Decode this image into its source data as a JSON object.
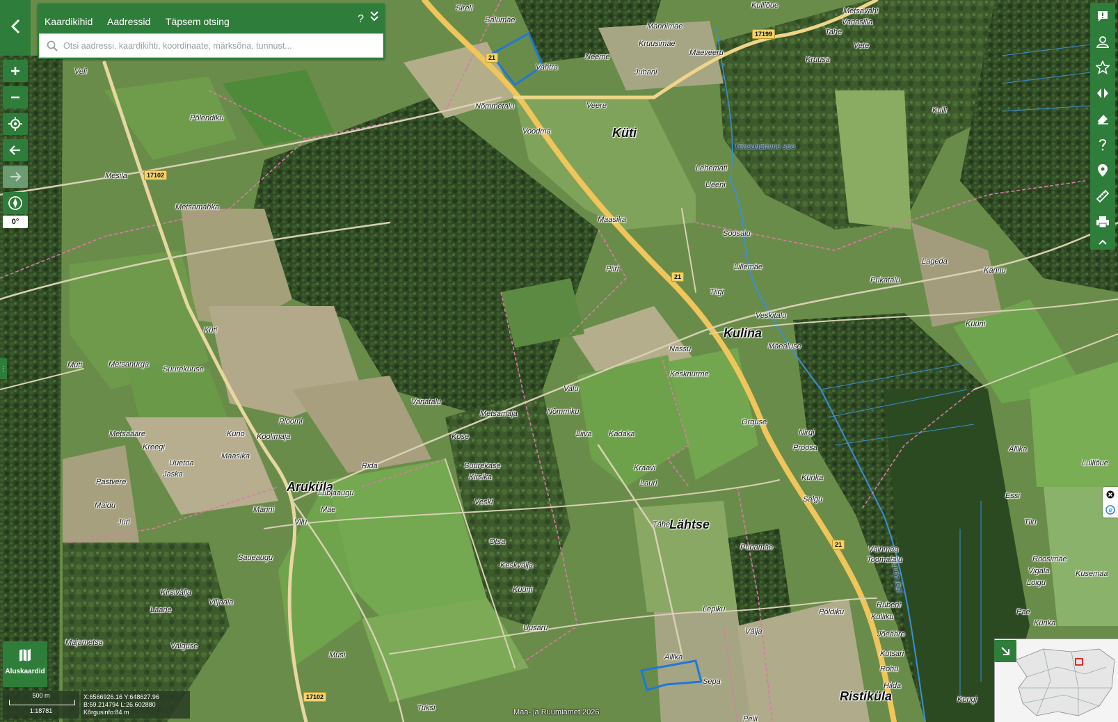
{
  "search_panel": {
    "tabs": [
      "Kaardikihid",
      "Aadressid",
      "Täpsem otsing"
    ],
    "help_label": "?",
    "placeholder": "Otsi aadressi, kaardikihti, koordinaate, märksõna, tunnust..."
  },
  "left_toolbar": {
    "buttons": [
      "zoom-in",
      "zoom-out",
      "locate",
      "back",
      "forward",
      "compass"
    ],
    "rotation": "0°"
  },
  "right_toolbar": {
    "buttons": [
      "feedback",
      "user",
      "favorites",
      "compare",
      "eraser",
      "help",
      "location-pin",
      "measure",
      "print",
      "collapse"
    ]
  },
  "basemap": {
    "label": "Aluskaardid"
  },
  "scale": {
    "distance": "500 m",
    "ratio": "1:18781"
  },
  "coords": {
    "xy": "X:6566926.16 Y:648627.96",
    "bl": "B:59.214794 L:26.602880",
    "height": "Kõrgusinfo:84 m"
  },
  "copyright": "Maa- ja Ruumiamet 2026",
  "road_numbers": [
    "21",
    "21",
    "21",
    "17199",
    "17102",
    "17102"
  ],
  "places": {
    "big": [
      "Küti",
      "Kulina",
      "Aruküla",
      "Lähtse",
      "Ristiküla"
    ],
    "small": [
      "Sireli",
      "Salumäe",
      "Männimäe",
      "Kulliõue",
      "Metsavahi",
      "Vanasilla",
      "Tahe",
      "Vete",
      "Kruusimäe",
      "Mäeveeru",
      "Kruusa",
      "Neeme",
      "Juhani",
      "Vahtra",
      "Veli",
      "Nõmmetalu",
      "Veere",
      "Voodma",
      "Kulli",
      "Põlendiku",
      "Lehemati",
      "Ueeni",
      "Mesila",
      "Metsamahka",
      "Maasika",
      "Soosalu",
      "Lillemäe",
      "Lageda",
      "Kännu",
      "Piiri",
      "Pukatalu",
      "Tiigi",
      "Veskitalu",
      "Küüni",
      "Mäealuse",
      "Küti",
      "Muti",
      "Metsanurga",
      "Suurekuuse",
      "Nassu",
      "Kesknurme",
      "Valu",
      "Vanatalu",
      "Nõmmiku",
      "Metsamaja",
      "Orguse",
      "Ploomi",
      "Metsaääre",
      "Kreegi",
      "Kuno",
      "Koolimaja",
      "Liiva",
      "Kadaka",
      "Kose",
      "Nirgi",
      "Proosa",
      "Allika",
      "Lulliõue",
      "Uuetoa",
      "Maasika",
      "Suurekase",
      "Kirsika",
      "Jaska",
      "Rida",
      "Kraavi",
      "Lauri",
      "Künka",
      "Salgu",
      "Pastvere",
      "Lubjaaugu",
      "Essi",
      "Maidu",
      "Männi",
      "Mäe",
      "Veski",
      "Jüri",
      "Vilu",
      "Tähe",
      "Väinmaa",
      "Toomatalu",
      "Tiiu",
      "Punamäe",
      "Roosimäe",
      "Vigala",
      "Kusemaa",
      "Saueaugu",
      "Otsa",
      "Loigu",
      "Keskvälja",
      "Kirsivälja",
      "Viljaaia",
      "Küüni",
      "Lepiku",
      "Põldiku",
      "Rubeni",
      "Pae",
      "Laane",
      "Kulliku",
      "Uusaru",
      "Välja",
      "Jõeääre",
      "Künka",
      "Majametsa",
      "Valguse",
      "Musi",
      "Allika",
      "Kutsari",
      "Rohu",
      "Hilda",
      "Sepa",
      "Kongi",
      "Tuksi",
      "Peili"
    ],
    "water": [
      "Tõnsunõmme soo",
      "Kunda jõgi"
    ]
  }
}
